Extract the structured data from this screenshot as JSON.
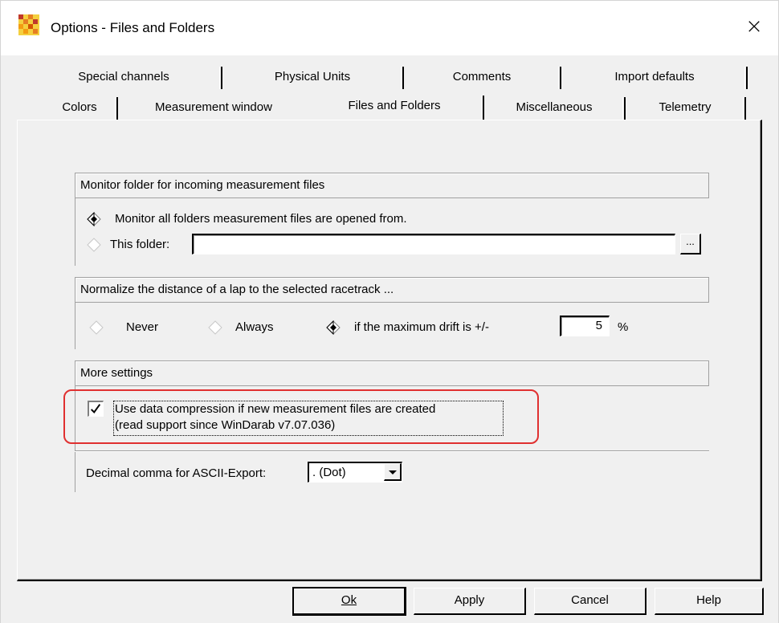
{
  "window": {
    "title": "Options - Files and Folders",
    "close_label": "×"
  },
  "tabs": {
    "row1": [
      "Special channels",
      "Physical Units",
      "Comments",
      "Import defaults"
    ],
    "row2": [
      "Colors",
      "Measurement window",
      "Files and Folders",
      "Miscellaneous",
      "Telemetry"
    ],
    "active": "Files and Folders"
  },
  "monitor_group": {
    "header": "Monitor folder for incoming measurement files",
    "option_all": "Monitor all folders measurement files are opened from.",
    "option_folder": "This folder:",
    "folder_value": "",
    "browse_label": "...",
    "selected": "option_all"
  },
  "normalize_group": {
    "header": "Normalize the distance of a lap to the selected racetrack ...",
    "option_never": "Never",
    "option_always": "Always",
    "option_drift": "if the maximum drift is +/-",
    "drift_value": "5",
    "drift_unit": "%",
    "selected": "option_drift"
  },
  "more_group": {
    "header": "More settings",
    "compression_line1": "Use data compression if new measurement files are created",
    "compression_line2": "(read support since WinDarab v7.07.036)",
    "compression_checked": true,
    "decimal_label": "Decimal comma for ASCII-Export:",
    "decimal_value": ". (Dot)"
  },
  "buttons": {
    "ok": "Ok",
    "apply": "Apply",
    "cancel": "Cancel",
    "help": "Help"
  },
  "colors": {
    "highlight": "#e03030",
    "background": "#f0f0f0"
  }
}
